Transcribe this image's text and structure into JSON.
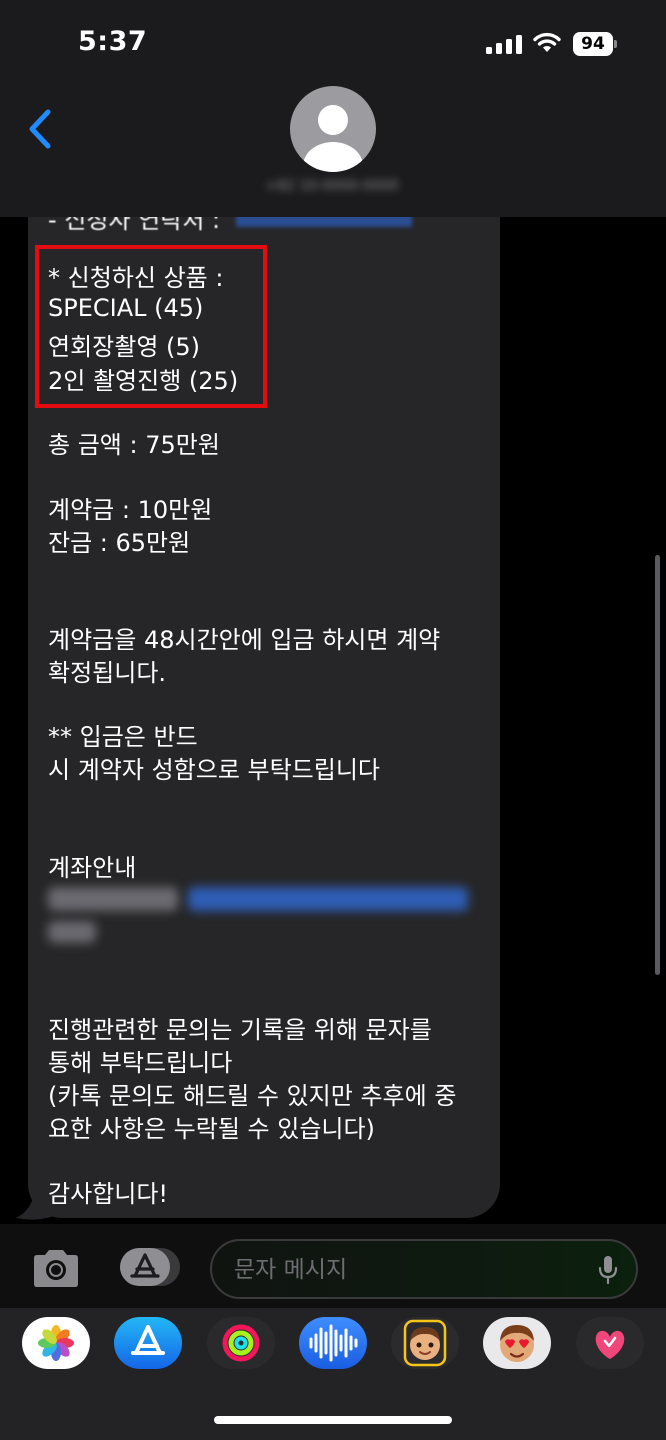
{
  "status_bar": {
    "time": "5:37",
    "battery": "94"
  },
  "contact": {
    "name": "+82 10-0000-0000"
  },
  "message": {
    "cut_line": "- 신청자 연락처 :",
    "highlight_lines": [
      "* 신청하신 상품 :",
      "SPECIAL (45)",
      "연회장촬영 (5)",
      "2인 촬영진행 (25)"
    ],
    "total": "총 금액 : 75만원",
    "deposit": "계약금 : 10만원",
    "balance": "잔금 : 65만원",
    "notice_1": "계약금을 48시간안에 입금 하시면 계약",
    "notice_2": "확정됩니다.",
    "note_1": "** 입금은 반드",
    "note_2": "시 계약자 성함으로 부탁드립니다",
    "account_title": "계좌안내",
    "inquiry_1": "진행관련한 문의는 기록을 위해 문자를",
    "inquiry_2": "통해 부탁드립니다",
    "inquiry_3": "(카톡 문의도 해드릴 수 있지만 추후에 중",
    "inquiry_4": "요한 사항은 누락될 수 있습니다)",
    "thanks": "감사합니다!"
  },
  "input": {
    "placeholder": "문자 메시지"
  },
  "icons": {
    "back": "chevron-left-icon",
    "camera": "camera-icon",
    "apps": "app-store-icon",
    "mic": "microphone-icon",
    "tray": [
      "photos-icon",
      "app-store-icon",
      "fitness-icon",
      "voice-memo-icon",
      "memoji-icon",
      "memoji-heart-eyes-icon",
      "digital-touch-icon"
    ]
  },
  "colors": {
    "accent": "#1f8bff",
    "highlight": "#e40c10",
    "bubble": "#262628"
  }
}
